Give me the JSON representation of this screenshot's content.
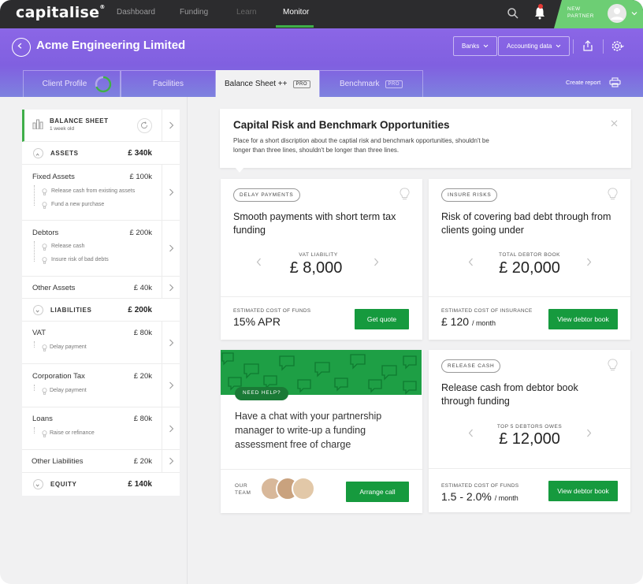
{
  "app": {
    "logo": "capitalise",
    "logo_mark": "®"
  },
  "nav": {
    "dashboard": "Dashboard",
    "funding": "Funding",
    "learn": "Learn",
    "monitor": "Monitor"
  },
  "partner": {
    "label": "NEW PARTNER"
  },
  "header": {
    "company": "Acme Engineering Limited",
    "banks": "Banks",
    "accounting": "Accounting data",
    "create_report": "Create report"
  },
  "tabs": [
    {
      "label": "Client Profile"
    },
    {
      "label": "Facilities"
    },
    {
      "label": "Balance Sheet ++",
      "badge": "PRO"
    },
    {
      "label": "Benchmark",
      "badge": "PRO"
    }
  ],
  "balance_sheet": {
    "title": "BALANCE SHEET",
    "subtitle": "1 week old",
    "assets": {
      "label": "ASSETS",
      "value": "£ 340k"
    },
    "fixed_assets": {
      "name": "Fixed Assets",
      "value": "£ 100k",
      "subs": [
        "Release cash from existing assets",
        "Fund a new purchase"
      ]
    },
    "debtors": {
      "name": "Debtors",
      "value": "£ 200k",
      "subs": [
        "Release cash",
        "Insure risk of bad debts"
      ]
    },
    "other_assets": {
      "name": "Other Assets",
      "value": "£ 40k"
    },
    "liabilities": {
      "label": "LIABILITIES",
      "value": "£ 200k"
    },
    "vat": {
      "name": "VAT",
      "value": "£ 80k",
      "sub": "Delay payment"
    },
    "corp_tax": {
      "name": "Corporation Tax",
      "value": "£ 20k",
      "sub": "Delay payment"
    },
    "loans": {
      "name": "Loans",
      "value": "£ 80k",
      "sub": "Raise or refinance"
    },
    "other_liabilities": {
      "name": "Other Liabilities",
      "value": "£ 20k"
    },
    "equity": {
      "label": "EQUITY",
      "value": "£ 140k"
    }
  },
  "intro": {
    "title": "Capital Risk and Benchmark Opportunities",
    "text": "Place for a short discription about the captial risk and benchmark opportunities, shouldn't be longer than three lines, shouldn't be longer than three lines."
  },
  "cards": {
    "delay": {
      "tag": "DELAY PAYMENTS",
      "title": "Smooth payments with short term tax funding",
      "value_label": "VAT LIABILITY",
      "value": "£ 8,000",
      "foot_label": "ESTIMATED COST OF FUNDS",
      "foot_value": "15% APR",
      "button": "Get quote"
    },
    "insure": {
      "tag": "INSURE RISKS",
      "title": "Risk of covering bad debt through from clients going under",
      "value_label": "TOTAL DEBTOR BOOK",
      "value": "£ 20,000",
      "foot_label": "ESTIMATED COST OF INSURANCE",
      "foot_value": "£ 120",
      "foot_unit": "/ month",
      "button": "View debtor book"
    },
    "help": {
      "tag": "NEED HELP?",
      "text": "Have a chat with your partnership manager to write-up a funding assessment free of charge",
      "team_label": "OUR TEAM",
      "button": "Arrange call"
    },
    "release": {
      "tag": "RELEASE CASH",
      "title": "Release cash from debtor book through funding",
      "value_label": "TOP 5 DEBTORS OWES",
      "value": "£ 12,000",
      "foot_label": "ESTIMATED COST OF FUNDS",
      "foot_value": "1.5 - 2.0%",
      "foot_unit": "/ month",
      "button": "View debtor book"
    }
  },
  "colors": {
    "accent": "#169a3e",
    "header": "#8262e2",
    "topbar": "#2c2c2e"
  }
}
